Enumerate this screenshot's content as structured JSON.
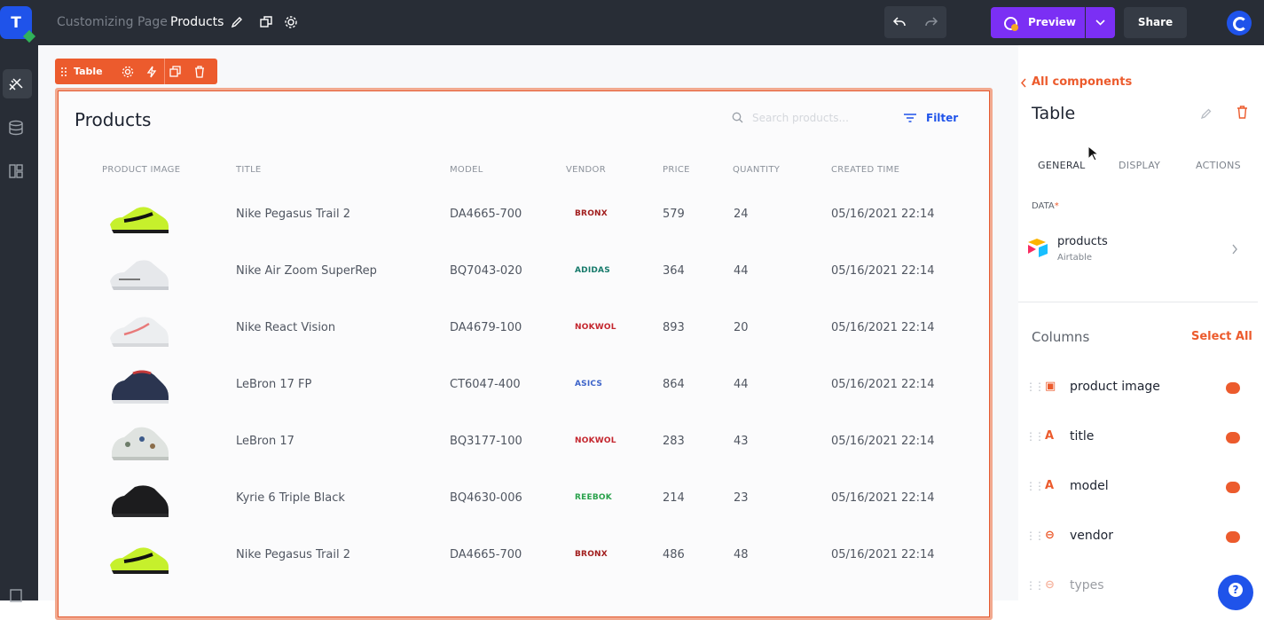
{
  "app": {
    "logo_letter": "T",
    "breadcrumb": {
      "parent": "Customizing Page",
      "current": "Products"
    },
    "actions": {
      "preview": "Preview",
      "share": "Share"
    }
  },
  "selection_toolbar": {
    "label": "Table"
  },
  "table": {
    "title": "Products",
    "search_placeholder": "Search products...",
    "filter_label": "Filter",
    "headers": [
      "PRODUCT IMAGE",
      "TITLE",
      "MODEL",
      "VENDOR",
      "PRICE",
      "QUANTITY",
      "CREATED TIME"
    ],
    "rows": [
      {
        "title": "Nike Pegasus Trail 2",
        "model": "DA4665-700",
        "vendor": "BRONX",
        "vendor_color": "#a11d1d",
        "price": "579",
        "quantity": "24",
        "created": "05/16/2021 22:14",
        "shoe": "volt"
      },
      {
        "title": "Nike Air Zoom SuperRep",
        "model": "BQ7043-020",
        "vendor": "ADIDAS",
        "vendor_color": "#177a6b",
        "price": "364",
        "quantity": "44",
        "created": "05/16/2021 22:14",
        "shoe": "white"
      },
      {
        "title": "Nike React Vision",
        "model": "DA4679-100",
        "vendor": "NOKWOL",
        "vendor_color": "#c4262e",
        "price": "893",
        "quantity": "20",
        "created": "05/16/2021 22:14",
        "shoe": "whitepink"
      },
      {
        "title": "LeBron 17 FP",
        "model": "CT6047-400",
        "vendor": "ASICS",
        "vendor_color": "#3c63c9",
        "price": "864",
        "quantity": "44",
        "created": "05/16/2021 22:14",
        "shoe": "navy"
      },
      {
        "title": "LeBron 17",
        "model": "BQ3177-100",
        "vendor": "NOKWOL",
        "vendor_color": "#c4262e",
        "price": "283",
        "quantity": "43",
        "created": "05/16/2021 22:14",
        "shoe": "camo"
      },
      {
        "title": "Kyrie 6 Triple Black",
        "model": "BQ4630-006",
        "vendor": "REEBOK",
        "vendor_color": "#2aa24c",
        "price": "214",
        "quantity": "23",
        "created": "05/16/2021 22:14",
        "shoe": "black"
      },
      {
        "title": "Nike Pegasus Trail 2",
        "model": "DA4665-700",
        "vendor": "BRONX",
        "vendor_color": "#a11d1d",
        "price": "486",
        "quantity": "48",
        "created": "05/16/2021 22:14",
        "shoe": "volt"
      }
    ]
  },
  "panel": {
    "back_label": "All components",
    "title": "Table",
    "tabs": [
      "GENERAL",
      "DISPLAY",
      "ACTIONS"
    ],
    "active_tab": "GENERAL",
    "data_label": "DATA",
    "data_required": "*",
    "datasource": {
      "name": "products",
      "type": "Airtable"
    },
    "columns_title": "Columns",
    "select_all": "Select All",
    "columns": [
      {
        "name": "product image",
        "icon": "image-icon",
        "on": true
      },
      {
        "name": "title",
        "icon": "text-icon",
        "on": true
      },
      {
        "name": "model",
        "icon": "text-icon",
        "on": true
      },
      {
        "name": "vendor",
        "icon": "select-icon",
        "on": true
      },
      {
        "name": "types",
        "icon": "select-icon",
        "on": false
      }
    ]
  },
  "colors": {
    "accent": "#ec5b2d",
    "primary": "#1f53ea",
    "preview": "#7b2ff4",
    "topbar": "#282d36"
  }
}
